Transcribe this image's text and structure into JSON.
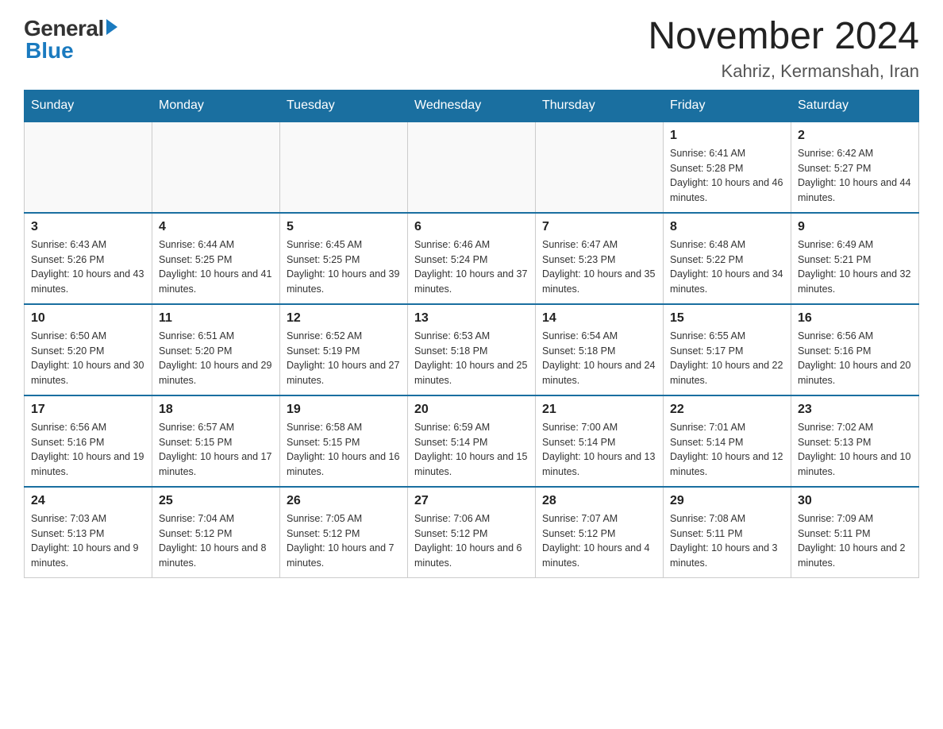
{
  "header": {
    "logo_general": "General",
    "logo_blue": "Blue",
    "month_title": "November 2024",
    "location": "Kahriz, Kermanshah, Iran"
  },
  "weekdays": [
    "Sunday",
    "Monday",
    "Tuesday",
    "Wednesday",
    "Thursday",
    "Friday",
    "Saturday"
  ],
  "weeks": [
    [
      {
        "day": "",
        "sunrise": "",
        "sunset": "",
        "daylight": ""
      },
      {
        "day": "",
        "sunrise": "",
        "sunset": "",
        "daylight": ""
      },
      {
        "day": "",
        "sunrise": "",
        "sunset": "",
        "daylight": ""
      },
      {
        "day": "",
        "sunrise": "",
        "sunset": "",
        "daylight": ""
      },
      {
        "day": "",
        "sunrise": "",
        "sunset": "",
        "daylight": ""
      },
      {
        "day": "1",
        "sunrise": "Sunrise: 6:41 AM",
        "sunset": "Sunset: 5:28 PM",
        "daylight": "Daylight: 10 hours and 46 minutes."
      },
      {
        "day": "2",
        "sunrise": "Sunrise: 6:42 AM",
        "sunset": "Sunset: 5:27 PM",
        "daylight": "Daylight: 10 hours and 44 minutes."
      }
    ],
    [
      {
        "day": "3",
        "sunrise": "Sunrise: 6:43 AM",
        "sunset": "Sunset: 5:26 PM",
        "daylight": "Daylight: 10 hours and 43 minutes."
      },
      {
        "day": "4",
        "sunrise": "Sunrise: 6:44 AM",
        "sunset": "Sunset: 5:25 PM",
        "daylight": "Daylight: 10 hours and 41 minutes."
      },
      {
        "day": "5",
        "sunrise": "Sunrise: 6:45 AM",
        "sunset": "Sunset: 5:25 PM",
        "daylight": "Daylight: 10 hours and 39 minutes."
      },
      {
        "day": "6",
        "sunrise": "Sunrise: 6:46 AM",
        "sunset": "Sunset: 5:24 PM",
        "daylight": "Daylight: 10 hours and 37 minutes."
      },
      {
        "day": "7",
        "sunrise": "Sunrise: 6:47 AM",
        "sunset": "Sunset: 5:23 PM",
        "daylight": "Daylight: 10 hours and 35 minutes."
      },
      {
        "day": "8",
        "sunrise": "Sunrise: 6:48 AM",
        "sunset": "Sunset: 5:22 PM",
        "daylight": "Daylight: 10 hours and 34 minutes."
      },
      {
        "day": "9",
        "sunrise": "Sunrise: 6:49 AM",
        "sunset": "Sunset: 5:21 PM",
        "daylight": "Daylight: 10 hours and 32 minutes."
      }
    ],
    [
      {
        "day": "10",
        "sunrise": "Sunrise: 6:50 AM",
        "sunset": "Sunset: 5:20 PM",
        "daylight": "Daylight: 10 hours and 30 minutes."
      },
      {
        "day": "11",
        "sunrise": "Sunrise: 6:51 AM",
        "sunset": "Sunset: 5:20 PM",
        "daylight": "Daylight: 10 hours and 29 minutes."
      },
      {
        "day": "12",
        "sunrise": "Sunrise: 6:52 AM",
        "sunset": "Sunset: 5:19 PM",
        "daylight": "Daylight: 10 hours and 27 minutes."
      },
      {
        "day": "13",
        "sunrise": "Sunrise: 6:53 AM",
        "sunset": "Sunset: 5:18 PM",
        "daylight": "Daylight: 10 hours and 25 minutes."
      },
      {
        "day": "14",
        "sunrise": "Sunrise: 6:54 AM",
        "sunset": "Sunset: 5:18 PM",
        "daylight": "Daylight: 10 hours and 24 minutes."
      },
      {
        "day": "15",
        "sunrise": "Sunrise: 6:55 AM",
        "sunset": "Sunset: 5:17 PM",
        "daylight": "Daylight: 10 hours and 22 minutes."
      },
      {
        "day": "16",
        "sunrise": "Sunrise: 6:56 AM",
        "sunset": "Sunset: 5:16 PM",
        "daylight": "Daylight: 10 hours and 20 minutes."
      }
    ],
    [
      {
        "day": "17",
        "sunrise": "Sunrise: 6:56 AM",
        "sunset": "Sunset: 5:16 PM",
        "daylight": "Daylight: 10 hours and 19 minutes."
      },
      {
        "day": "18",
        "sunrise": "Sunrise: 6:57 AM",
        "sunset": "Sunset: 5:15 PM",
        "daylight": "Daylight: 10 hours and 17 minutes."
      },
      {
        "day": "19",
        "sunrise": "Sunrise: 6:58 AM",
        "sunset": "Sunset: 5:15 PM",
        "daylight": "Daylight: 10 hours and 16 minutes."
      },
      {
        "day": "20",
        "sunrise": "Sunrise: 6:59 AM",
        "sunset": "Sunset: 5:14 PM",
        "daylight": "Daylight: 10 hours and 15 minutes."
      },
      {
        "day": "21",
        "sunrise": "Sunrise: 7:00 AM",
        "sunset": "Sunset: 5:14 PM",
        "daylight": "Daylight: 10 hours and 13 minutes."
      },
      {
        "day": "22",
        "sunrise": "Sunrise: 7:01 AM",
        "sunset": "Sunset: 5:14 PM",
        "daylight": "Daylight: 10 hours and 12 minutes."
      },
      {
        "day": "23",
        "sunrise": "Sunrise: 7:02 AM",
        "sunset": "Sunset: 5:13 PM",
        "daylight": "Daylight: 10 hours and 10 minutes."
      }
    ],
    [
      {
        "day": "24",
        "sunrise": "Sunrise: 7:03 AM",
        "sunset": "Sunset: 5:13 PM",
        "daylight": "Daylight: 10 hours and 9 minutes."
      },
      {
        "day": "25",
        "sunrise": "Sunrise: 7:04 AM",
        "sunset": "Sunset: 5:12 PM",
        "daylight": "Daylight: 10 hours and 8 minutes."
      },
      {
        "day": "26",
        "sunrise": "Sunrise: 7:05 AM",
        "sunset": "Sunset: 5:12 PM",
        "daylight": "Daylight: 10 hours and 7 minutes."
      },
      {
        "day": "27",
        "sunrise": "Sunrise: 7:06 AM",
        "sunset": "Sunset: 5:12 PM",
        "daylight": "Daylight: 10 hours and 6 minutes."
      },
      {
        "day": "28",
        "sunrise": "Sunrise: 7:07 AM",
        "sunset": "Sunset: 5:12 PM",
        "daylight": "Daylight: 10 hours and 4 minutes."
      },
      {
        "day": "29",
        "sunrise": "Sunrise: 7:08 AM",
        "sunset": "Sunset: 5:11 PM",
        "daylight": "Daylight: 10 hours and 3 minutes."
      },
      {
        "day": "30",
        "sunrise": "Sunrise: 7:09 AM",
        "sunset": "Sunset: 5:11 PM",
        "daylight": "Daylight: 10 hours and 2 minutes."
      }
    ]
  ]
}
